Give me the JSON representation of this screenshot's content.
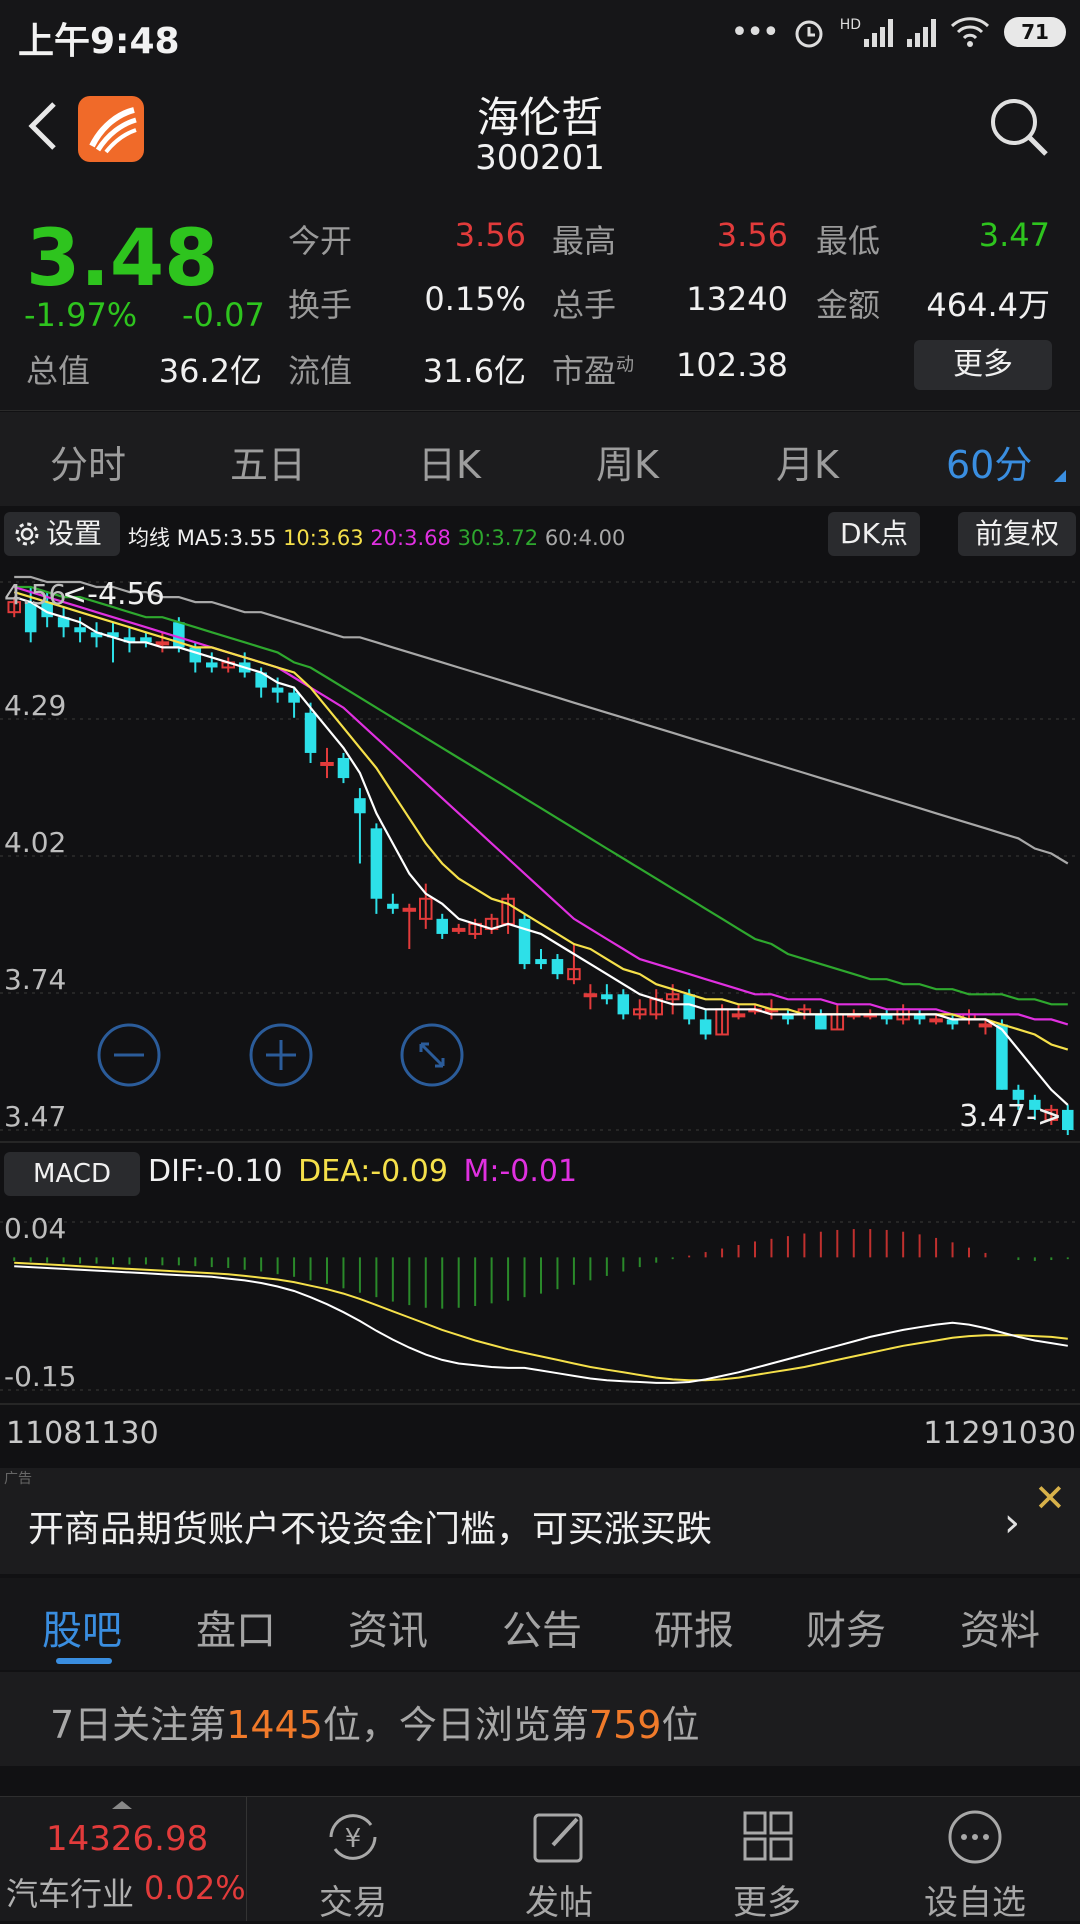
{
  "status_bar": {
    "time": "上午9:48",
    "battery": "71",
    "network": "HD"
  },
  "header": {
    "stock_name": "海伦哲",
    "stock_code": "300201"
  },
  "quote": {
    "price": "3.48",
    "change_pct": "-1.97%",
    "change": "-0.07",
    "open_label": "今开",
    "open": "3.56",
    "high_label": "最高",
    "high": "3.56",
    "low_label": "最低",
    "low": "3.47",
    "turnover_label": "换手",
    "turnover": "0.15%",
    "volume_label": "总手",
    "volume": "13240",
    "amount_label": "金额",
    "amount": "464.4万",
    "total_value_label": "总值",
    "total_value": "36.2亿",
    "float_value_label": "流值",
    "float_value": "31.6亿",
    "pe_label": "市盈",
    "pe_sup": "动",
    "pe": "102.38",
    "more_label": "更多"
  },
  "period_tabs": [
    "分时",
    "五日",
    "日K",
    "周K",
    "月K",
    "60分"
  ],
  "active_period": 5,
  "ma_bar": {
    "settings_label": "设置",
    "ma_prefix": "均线",
    "ma5": "MA5:3.55",
    "ma10": "10:3.63",
    "ma20": "20:3.68",
    "ma30": "30:3.72",
    "ma60": "60:4.00",
    "dk_label": "DK点",
    "adjust_label": "前复权"
  },
  "colors": {
    "ma5": "#ffffff",
    "ma10": "#f5e04a",
    "ma20": "#e030e0",
    "ma30": "#2ea82e",
    "ma60": "#a8a8a8",
    "up": "#e23b3b",
    "down": "#2de0e8",
    "accent": "#3a8ee0"
  },
  "chart_data": {
    "type": "candlestick",
    "y_labels": [
      "4.56",
      "4.29",
      "4.02",
      "3.74",
      "3.47"
    ],
    "ylim": [
      3.47,
      4.56
    ],
    "max_marker": "<-4.56",
    "min_marker": "3.47->",
    "candles": [
      [
        4.5,
        4.52,
        4.53,
        4.49
      ],
      [
        4.52,
        4.46,
        4.55,
        4.44
      ],
      [
        4.52,
        4.49,
        4.54,
        4.47
      ],
      [
        4.49,
        4.47,
        4.51,
        4.45
      ],
      [
        4.47,
        4.46,
        4.49,
        4.44
      ],
      [
        4.46,
        4.45,
        4.48,
        4.43
      ],
      [
        4.46,
        4.45,
        4.48,
        4.4
      ],
      [
        4.45,
        4.44,
        4.47,
        4.42
      ],
      [
        4.45,
        4.44,
        4.46,
        4.43
      ],
      [
        4.44,
        4.44,
        4.46,
        4.42
      ],
      [
        4.48,
        4.43,
        4.49,
        4.42
      ],
      [
        4.43,
        4.4,
        4.44,
        4.38
      ],
      [
        4.4,
        4.39,
        4.42,
        4.38
      ],
      [
        4.39,
        4.4,
        4.41,
        4.38
      ],
      [
        4.4,
        4.38,
        4.42,
        4.37
      ],
      [
        4.38,
        4.35,
        4.39,
        4.33
      ],
      [
        4.35,
        4.34,
        4.37,
        4.32
      ],
      [
        4.34,
        4.32,
        4.35,
        4.29
      ],
      [
        4.3,
        4.22,
        4.32,
        4.2
      ],
      [
        4.2,
        4.2,
        4.23,
        4.17
      ],
      [
        4.21,
        4.17,
        4.22,
        4.16
      ],
      [
        4.13,
        4.1,
        4.15,
        4.0
      ],
      [
        4.07,
        3.93,
        4.08,
        3.9
      ],
      [
        3.92,
        3.91,
        3.94,
        3.9
      ],
      [
        3.91,
        3.91,
        3.92,
        3.83
      ],
      [
        3.89,
        3.93,
        3.96,
        3.87
      ],
      [
        3.89,
        3.86,
        3.9,
        3.85
      ],
      [
        3.87,
        3.87,
        3.88,
        3.86
      ],
      [
        3.86,
        3.88,
        3.89,
        3.85
      ],
      [
        3.87,
        3.89,
        3.9,
        3.86
      ],
      [
        3.88,
        3.93,
        3.94,
        3.86
      ],
      [
        3.89,
        3.8,
        3.9,
        3.79
      ],
      [
        3.81,
        3.8,
        3.83,
        3.79
      ],
      [
        3.81,
        3.78,
        3.82,
        3.77
      ],
      [
        3.77,
        3.79,
        3.84,
        3.76
      ],
      [
        3.74,
        3.74,
        3.76,
        3.71
      ],
      [
        3.74,
        3.73,
        3.76,
        3.72
      ],
      [
        3.74,
        3.7,
        3.75,
        3.69
      ],
      [
        3.7,
        3.71,
        3.73,
        3.69
      ],
      [
        3.7,
        3.73,
        3.75,
        3.69
      ],
      [
        3.73,
        3.74,
        3.76,
        3.7
      ],
      [
        3.74,
        3.69,
        3.75,
        3.68
      ],
      [
        3.69,
        3.66,
        3.71,
        3.65
      ],
      [
        3.66,
        3.71,
        3.72,
        3.66
      ],
      [
        3.7,
        3.7,
        3.72,
        3.69
      ],
      [
        3.71,
        3.71,
        3.72,
        3.7
      ],
      [
        3.71,
        3.71,
        3.73,
        3.69
      ],
      [
        3.7,
        3.69,
        3.71,
        3.68
      ],
      [
        3.7,
        3.71,
        3.72,
        3.69
      ],
      [
        3.7,
        3.67,
        3.71,
        3.67
      ],
      [
        3.67,
        3.7,
        3.72,
        3.67
      ],
      [
        3.7,
        3.7,
        3.71,
        3.69
      ],
      [
        3.7,
        3.7,
        3.71,
        3.69
      ],
      [
        3.7,
        3.69,
        3.71,
        3.68
      ],
      [
        3.69,
        3.71,
        3.72,
        3.68
      ],
      [
        3.7,
        3.69,
        3.71,
        3.68
      ],
      [
        3.69,
        3.69,
        3.7,
        3.68
      ],
      [
        3.69,
        3.68,
        3.7,
        3.67
      ],
      [
        3.69,
        3.7,
        3.71,
        3.68
      ],
      [
        3.68,
        3.68,
        3.69,
        3.66
      ],
      [
        3.68,
        3.55,
        3.69,
        3.55
      ],
      [
        3.55,
        3.53,
        3.56,
        3.51
      ],
      [
        3.53,
        3.51,
        3.54,
        3.49
      ],
      [
        3.49,
        3.51,
        3.52,
        3.48
      ],
      [
        3.51,
        3.47,
        3.52,
        3.46
      ]
    ],
    "ma5": [
      4.53,
      4.52,
      4.5,
      4.49,
      4.48,
      4.46,
      4.45,
      4.44,
      4.44,
      4.43,
      4.43,
      4.42,
      4.41,
      4.4,
      4.39,
      4.38,
      4.36,
      4.35,
      4.31,
      4.27,
      4.23,
      4.18,
      4.1,
      4.04,
      3.98,
      3.94,
      3.92,
      3.89,
      3.88,
      3.87,
      3.88,
      3.87,
      3.86,
      3.84,
      3.82,
      3.8,
      3.78,
      3.76,
      3.74,
      3.73,
      3.72,
      3.72,
      3.71,
      3.71,
      3.71,
      3.71,
      3.7,
      3.7,
      3.7,
      3.7,
      3.7,
      3.7,
      3.7,
      3.7,
      3.7,
      3.7,
      3.7,
      3.69,
      3.69,
      3.69,
      3.67,
      3.63,
      3.59,
      3.55,
      3.52
    ],
    "ma10": [
      4.54,
      4.53,
      4.52,
      4.51,
      4.5,
      4.49,
      4.48,
      4.47,
      4.46,
      4.45,
      4.44,
      4.43,
      4.43,
      4.42,
      4.41,
      4.4,
      4.39,
      4.38,
      4.35,
      4.31,
      4.27,
      4.23,
      4.19,
      4.14,
      4.09,
      4.04,
      4.0,
      3.97,
      3.95,
      3.93,
      3.92,
      3.9,
      3.88,
      3.86,
      3.84,
      3.83,
      3.81,
      3.79,
      3.78,
      3.76,
      3.75,
      3.74,
      3.73,
      3.73,
      3.72,
      3.72,
      3.71,
      3.71,
      3.7,
      3.7,
      3.7,
      3.7,
      3.7,
      3.7,
      3.7,
      3.7,
      3.7,
      3.7,
      3.69,
      3.69,
      3.68,
      3.67,
      3.66,
      3.64,
      3.63
    ],
    "ma20": [
      4.55,
      4.54,
      4.53,
      4.52,
      4.51,
      4.5,
      4.49,
      4.48,
      4.47,
      4.46,
      4.45,
      4.44,
      4.43,
      4.42,
      4.41,
      4.4,
      4.39,
      4.37,
      4.35,
      4.33,
      4.31,
      4.28,
      4.25,
      4.22,
      4.19,
      4.16,
      4.13,
      4.1,
      4.07,
      4.04,
      4.01,
      3.98,
      3.95,
      3.92,
      3.89,
      3.87,
      3.85,
      3.83,
      3.81,
      3.8,
      3.79,
      3.78,
      3.77,
      3.76,
      3.75,
      3.74,
      3.74,
      3.73,
      3.73,
      3.73,
      3.72,
      3.72,
      3.72,
      3.71,
      3.71,
      3.71,
      3.71,
      3.7,
      3.7,
      3.7,
      3.7,
      3.7,
      3.69,
      3.69,
      3.68
    ],
    "ma30": [
      4.55,
      4.55,
      4.54,
      4.53,
      4.53,
      4.52,
      4.51,
      4.5,
      4.49,
      4.49,
      4.48,
      4.47,
      4.46,
      4.45,
      4.44,
      4.43,
      4.42,
      4.4,
      4.39,
      4.37,
      4.35,
      4.33,
      4.31,
      4.29,
      4.27,
      4.25,
      4.23,
      4.21,
      4.19,
      4.17,
      4.15,
      4.13,
      4.11,
      4.09,
      4.07,
      4.05,
      4.03,
      4.01,
      3.99,
      3.97,
      3.95,
      3.93,
      3.91,
      3.89,
      3.87,
      3.85,
      3.84,
      3.82,
      3.81,
      3.8,
      3.79,
      3.78,
      3.77,
      3.77,
      3.76,
      3.76,
      3.75,
      3.75,
      3.74,
      3.74,
      3.74,
      3.73,
      3.73,
      3.72,
      3.72
    ],
    "ma60": [
      4.57,
      4.57,
      4.56,
      4.56,
      4.56,
      4.55,
      4.55,
      4.54,
      4.54,
      4.53,
      4.53,
      4.52,
      4.52,
      4.51,
      4.5,
      4.5,
      4.49,
      4.48,
      4.47,
      4.46,
      4.45,
      4.45,
      4.44,
      4.43,
      4.42,
      4.41,
      4.4,
      4.39,
      4.38,
      4.37,
      4.36,
      4.35,
      4.34,
      4.33,
      4.32,
      4.31,
      4.3,
      4.29,
      4.28,
      4.27,
      4.26,
      4.25,
      4.24,
      4.23,
      4.22,
      4.21,
      4.2,
      4.19,
      4.18,
      4.17,
      4.16,
      4.15,
      4.14,
      4.13,
      4.12,
      4.11,
      4.1,
      4.09,
      4.08,
      4.07,
      4.06,
      4.05,
      4.03,
      4.02,
      4.0
    ]
  },
  "macd": {
    "button_label": "MACD",
    "dif": "DIF:-0.10",
    "dea": "DEA:-0.09",
    "m": "M:-0.01",
    "y_labels": [
      "0.04",
      "-0.15"
    ],
    "ylim": [
      -0.15,
      0.04
    ],
    "bars": [
      -0.004,
      -0.005,
      -0.006,
      -0.006,
      -0.007,
      -0.007,
      -0.008,
      -0.008,
      -0.008,
      -0.009,
      -0.009,
      -0.01,
      -0.011,
      -0.012,
      -0.014,
      -0.016,
      -0.019,
      -0.022,
      -0.026,
      -0.03,
      -0.035,
      -0.04,
      -0.045,
      -0.05,
      -0.054,
      -0.057,
      -0.058,
      -0.057,
      -0.055,
      -0.052,
      -0.049,
      -0.045,
      -0.041,
      -0.036,
      -0.031,
      -0.026,
      -0.021,
      -0.016,
      -0.011,
      -0.006,
      -0.002,
      0.002,
      0.006,
      0.01,
      0.014,
      0.018,
      0.021,
      0.024,
      0.027,
      0.029,
      0.031,
      0.032,
      0.032,
      0.031,
      0.029,
      0.026,
      0.022,
      0.017,
      0.011,
      0.005,
      0.0,
      -0.003,
      -0.004,
      -0.003,
      -0.002
    ],
    "dif_line": [
      -0.01,
      -0.011,
      -0.012,
      -0.013,
      -0.014,
      -0.015,
      -0.016,
      -0.017,
      -0.018,
      -0.019,
      -0.02,
      -0.021,
      -0.022,
      -0.024,
      -0.026,
      -0.029,
      -0.033,
      -0.038,
      -0.045,
      -0.053,
      -0.062,
      -0.072,
      -0.083,
      -0.093,
      -0.102,
      -0.11,
      -0.116,
      -0.12,
      -0.122,
      -0.124,
      -0.125,
      -0.125,
      -0.128,
      -0.131,
      -0.134,
      -0.137,
      -0.139,
      -0.14,
      -0.141,
      -0.142,
      -0.142,
      -0.141,
      -0.138,
      -0.134,
      -0.13,
      -0.125,
      -0.12,
      -0.115,
      -0.11,
      -0.105,
      -0.1,
      -0.095,
      -0.09,
      -0.086,
      -0.082,
      -0.079,
      -0.076,
      -0.074,
      -0.076,
      -0.08,
      -0.085,
      -0.09,
      -0.094,
      -0.097,
      -0.1
    ],
    "dea_line": [
      -0.006,
      -0.007,
      -0.008,
      -0.009,
      -0.01,
      -0.011,
      -0.012,
      -0.013,
      -0.014,
      -0.015,
      -0.016,
      -0.017,
      -0.018,
      -0.019,
      -0.021,
      -0.023,
      -0.025,
      -0.028,
      -0.032,
      -0.036,
      -0.041,
      -0.047,
      -0.054,
      -0.061,
      -0.068,
      -0.075,
      -0.082,
      -0.088,
      -0.094,
      -0.099,
      -0.104,
      -0.108,
      -0.112,
      -0.116,
      -0.12,
      -0.124,
      -0.127,
      -0.13,
      -0.133,
      -0.136,
      -0.138,
      -0.139,
      -0.139,
      -0.138,
      -0.136,
      -0.133,
      -0.13,
      -0.127,
      -0.124,
      -0.12,
      -0.116,
      -0.112,
      -0.108,
      -0.104,
      -0.1,
      -0.097,
      -0.094,
      -0.091,
      -0.089,
      -0.088,
      -0.088,
      -0.088,
      -0.089,
      -0.09,
      -0.092
    ]
  },
  "time_labels": {
    "start": "11081130",
    "end": "11291030"
  },
  "ad": {
    "tag": "广告",
    "text": "开商品期货账户不设资金门槛，可买涨买跌"
  },
  "content_tabs": [
    "股吧",
    "盘口",
    "资讯",
    "公告",
    "研报",
    "财务",
    "资料"
  ],
  "active_content_tab": 0,
  "rank": {
    "p1": "7日关注第",
    "n1": "1445",
    "p2": "位，今日浏览第",
    "n2": "759",
    "p3": "位"
  },
  "bottom_nav": {
    "index_value": "14326.98",
    "index_name": "汽车行业",
    "index_pct": "0.02%",
    "items": [
      {
        "label": "交易",
        "icon": "trade-icon"
      },
      {
        "label": "发帖",
        "icon": "post-icon"
      },
      {
        "label": "更多",
        "icon": "grid-icon"
      },
      {
        "label": "设自选",
        "icon": "more-dots-icon"
      }
    ]
  }
}
